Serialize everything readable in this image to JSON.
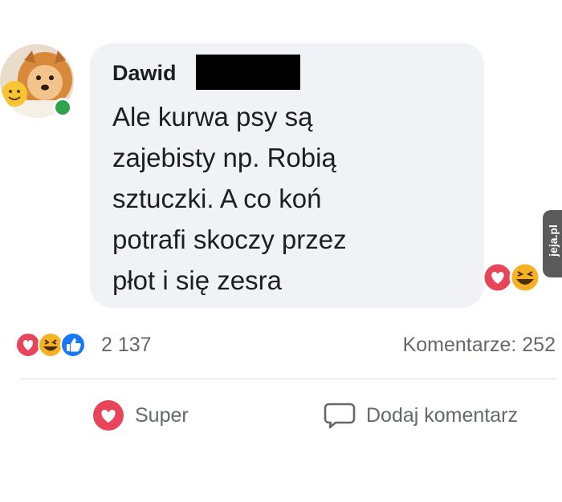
{
  "post": {
    "author": "Dawid",
    "message_lines": [
      "Ale kurwa psy są",
      "zajebisty np. Robią",
      "sztuczki. A co koń",
      "potrafi skoczy przez",
      "płot i się zesra"
    ]
  },
  "stats": {
    "reaction_count": "2 137",
    "comments_label": "Komentarze: 252"
  },
  "actions": {
    "super_label": "Super",
    "comment_label": "Dodaj komentarz"
  },
  "watermark": {
    "text": "jeja.pl"
  },
  "colors": {
    "bubble": "#f0f2f5",
    "love": "#e8445a",
    "haha": "#f7b125",
    "like": "#1877f2",
    "online": "#31a24c",
    "muted_text": "#65676b"
  },
  "icons": [
    "love-reaction-icon",
    "haha-reaction-icon",
    "like-reaction-icon",
    "heart-outline-icon",
    "comment-bubble-icon"
  ]
}
